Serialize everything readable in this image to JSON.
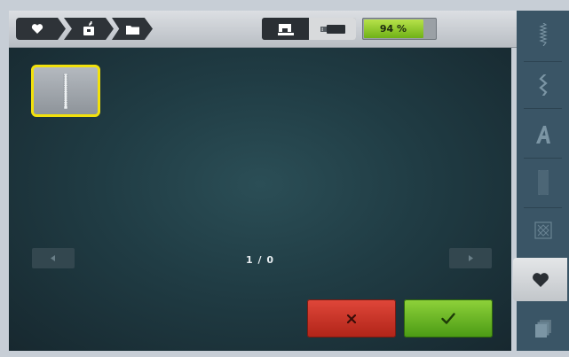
{
  "breadcrumb": {
    "items": [
      {
        "icon": "heart-icon"
      },
      {
        "icon": "machine-memory-icon"
      },
      {
        "icon": "folder-icon"
      }
    ]
  },
  "mode_toggle": {
    "options": [
      {
        "icon": "sewing-machine-icon",
        "active": true
      },
      {
        "icon": "usb-stick-icon",
        "active": false
      }
    ]
  },
  "battery": {
    "label": "94 %",
    "level": 0.94,
    "color": "#7cc01f"
  },
  "stitch_grid": {
    "items": [
      {
        "icon": "straight-stitch-icon",
        "selected": true
      }
    ],
    "selected_color": "#f2e10c"
  },
  "pagination": {
    "counter": "1 / 0"
  },
  "actions": {
    "cancel": {
      "icon": "close-x-icon",
      "color": "#c8342a"
    },
    "confirm": {
      "icon": "checkmark-icon",
      "color": "#6ab42a"
    }
  },
  "sidebar": {
    "tabs": [
      {
        "icon": "practical-stitches-icon",
        "active": false
      },
      {
        "icon": "decorative-stitches-icon",
        "active": false
      },
      {
        "icon": "alphabets-icon",
        "active": false
      },
      {
        "icon": "buttonholes-icon",
        "active": false
      },
      {
        "icon": "quilt-stitches-icon",
        "active": false
      },
      {
        "icon": "heart-icon",
        "active": true
      },
      {
        "icon": "history-icon",
        "active": false
      }
    ]
  }
}
